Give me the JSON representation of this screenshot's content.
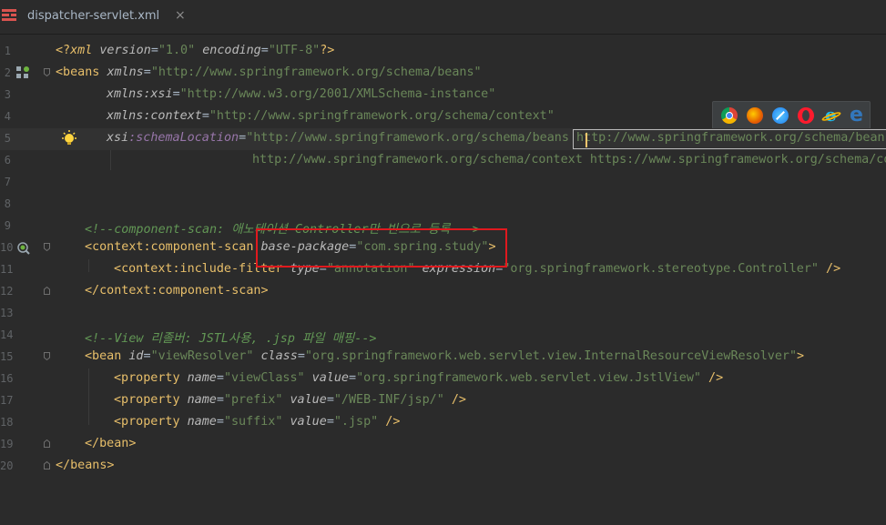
{
  "tab": {
    "title": "dispatcher-servlet.xml",
    "close": "×"
  },
  "icons": {
    "file": "xml-file-icon",
    "bulb": "lightbulb-icon",
    "bean": "spring-bean-icon",
    "scan": "spring-scan-icon",
    "browsers": [
      "chrome-icon",
      "firefox-icon",
      "safari-icon",
      "opera-icon",
      "ie-icon",
      "edge-icon"
    ]
  },
  "lines": [
    {
      "n": "1"
    },
    {
      "n": "2"
    },
    {
      "n": "3"
    },
    {
      "n": "4"
    },
    {
      "n": "5"
    },
    {
      "n": "6"
    },
    {
      "n": "7"
    },
    {
      "n": "8"
    },
    {
      "n": "9"
    },
    {
      "n": "10"
    },
    {
      "n": "11"
    },
    {
      "n": "12"
    },
    {
      "n": "13"
    },
    {
      "n": "14"
    },
    {
      "n": "15"
    },
    {
      "n": "16"
    },
    {
      "n": "17"
    },
    {
      "n": "18"
    },
    {
      "n": "19"
    },
    {
      "n": "20"
    }
  ],
  "code": {
    "l1": {
      "a": "<?",
      "b": "xml",
      "c": " version",
      "d": "=",
      "e": "\"1.0\"",
      "f": " encoding",
      "g": "=",
      "h": "\"UTF-8\"",
      "i": "?>"
    },
    "l2": {
      "a": "<beans ",
      "b": "xmlns",
      "c": "=",
      "d": "\"http://www.springframework.org/schema/beans\""
    },
    "l3": {
      "a": "xmlns",
      "b": ":xsi",
      "c": "=",
      "d": "\"http://www.w3.org/2001/XMLSchema-instance\""
    },
    "l4": {
      "a": "xmlns",
      "b": ":context",
      "c": "=",
      "d": "\"http://www.springframework.org/schema/context\""
    },
    "l5": {
      "a": "xsi",
      "b": ":schemaLocation",
      "c": "=",
      "d": "\"http://www.springframework.org/schema/beans ",
      "e": "http://www.springframework.org/schema/beans"
    },
    "l6": {
      "a": "http://www.springframework.org/schema/context https://www.springframework.org/schema/co"
    },
    "l9": {
      "a": "<!--component-scan: 애노테이션 Controller만 빈으로 등록 -->"
    },
    "l10": {
      "a": "<",
      "b": "context",
      "c": ":component-scan ",
      "d": "base-package",
      "e": "=",
      "f": "\"com.spring.study\"",
      "g": ">"
    },
    "l11": {
      "a": "<",
      "b": "context",
      "c": ":include-filter ",
      "d": "type",
      "e": "=",
      "f": "\"annotation\"",
      "g": " expression",
      "h": "=",
      "i": "\"org.springframework.stereotype.Controller\"",
      "j": " />"
    },
    "l12": {
      "a": "</",
      "b": "context",
      "c": ":component-scan",
      "d": ">"
    },
    "l14": {
      "a": "<!--View 리졸버: JSTL사용, .jsp 파일 매핑-->"
    },
    "l15": {
      "a": "<bean ",
      "b": "id",
      "c": "=",
      "d": "\"viewResolver\"",
      "e": " class",
      "f": "=",
      "g": "\"org.springframework.web.servlet.view.InternalResourceViewResolver\"",
      "h": ">"
    },
    "l16": {
      "a": "<property ",
      "b": "name",
      "c": "=",
      "d": "\"viewClass\"",
      "e": " value",
      "f": "=",
      "g": "\"org.springframework.web.servlet.view.JstlView\"",
      "h": " />"
    },
    "l17": {
      "a": "<property ",
      "b": "name",
      "c": "=",
      "d": "\"prefix\"",
      "e": " value",
      "f": "=",
      "g": "\"/WEB-INF/jsp/\"",
      "h": " />"
    },
    "l18": {
      "a": "<property ",
      "b": "name",
      "c": "=",
      "d": "\"suffix\"",
      "e": " value",
      "f": "=",
      "g": "\".jsp\"",
      "h": " />"
    },
    "l19": {
      "a": "</bean>"
    },
    "l20": {
      "a": "</beans>"
    }
  },
  "colors": {
    "background": "#2b2b2b",
    "tag": "#e8bf6a",
    "value": "#6a8759",
    "namespace": "#9876aa",
    "comment": "#629755",
    "highlight": "#e0191e"
  }
}
